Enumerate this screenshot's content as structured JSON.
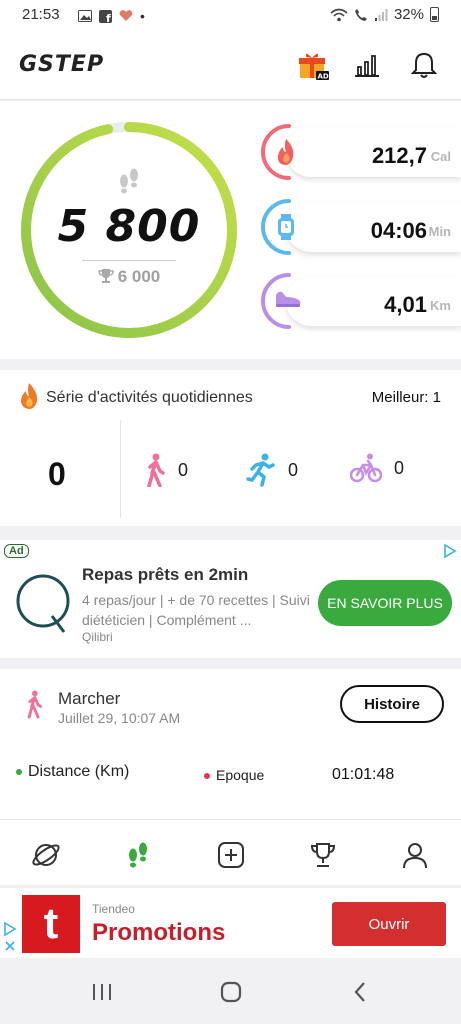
{
  "status_bar": {
    "time": "21:53",
    "battery": "32%"
  },
  "header": {
    "logo": "GSTEP",
    "gift_badge": "AD"
  },
  "steps": {
    "count": "5 800",
    "goal": "6 000",
    "progress_fraction": 0.967
  },
  "metrics": [
    {
      "value": "212,7",
      "unit": "Cal",
      "icon": "flame-icon",
      "color": "#f06a7a"
    },
    {
      "value": "04:06",
      "unit": "Min",
      "icon": "watch-icon",
      "color": "#5bb8f0"
    },
    {
      "value": "4,01",
      "unit": "Km",
      "icon": "shoe-icon",
      "color": "#b890e8"
    }
  ],
  "streak": {
    "title": "Série d'activités quotidiennes",
    "best": "Meilleur: 1",
    "count": "0",
    "walk": "0",
    "run": "0",
    "bike": "0"
  },
  "ad": {
    "badge": "Ad",
    "title": "Repas prêts en 2min",
    "description": "4 repas/jour | + de 70 recettes | Suivi diététicien | Complément ...",
    "brand": "Qilibri",
    "cta": "EN SAVOIR PLUS"
  },
  "history": {
    "activity": "Marcher",
    "date": "Juillet 29, 10:07 AM",
    "button": "Histoire",
    "distance_label": "Distance (Km)",
    "epoch_label": "Epoque",
    "epoch_value": "01:01:48"
  },
  "banner": {
    "brand": "Tiendeo",
    "title": "Promotions",
    "logo_letter": "t",
    "cta": "Ouvrir"
  },
  "colors": {
    "ring_green": "#8bc34a",
    "cta_green": "#3aaa3f",
    "banner_red": "#d32f2f"
  }
}
